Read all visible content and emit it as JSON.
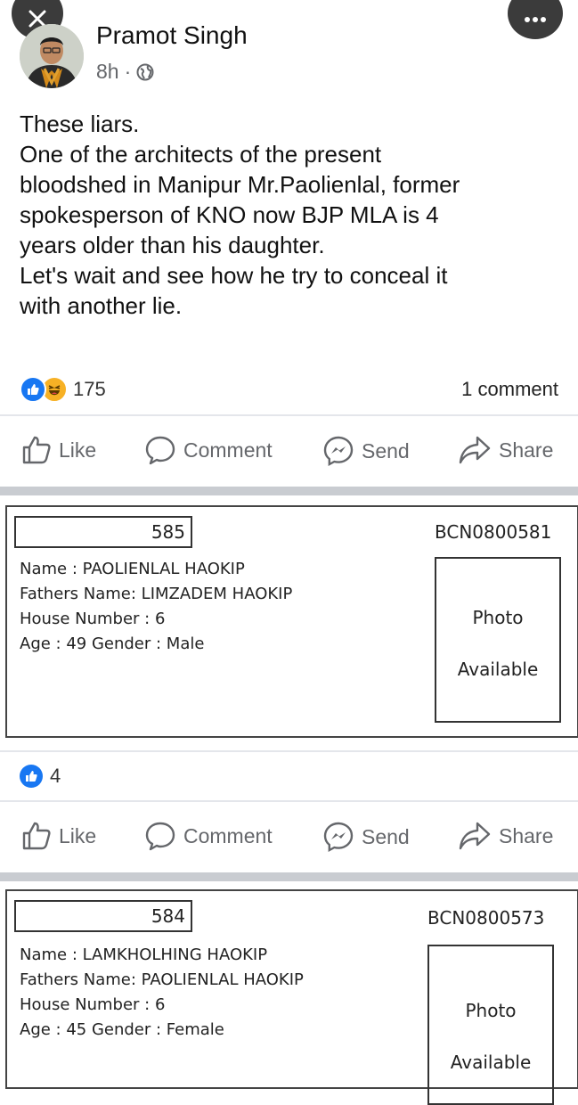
{
  "top_controls": {
    "close_icon": "close-icon",
    "more_icon": "more-options-icon"
  },
  "post": {
    "author": "Pramot Singh",
    "time": "8h",
    "separator": "·",
    "privacy_icon": "globe-icon",
    "text_lines": [
      "These liars.",
      "One of the architects of the present",
      "bloodshed in Manipur Mr.Paolienlal, former",
      "spokesperson of KNO now BJP MLA is 4",
      "years older than his daughter.",
      "Let's wait and see how he try to conceal it",
      "with another lie."
    ],
    "reaction_count": "175",
    "comment_count": "1 comment"
  },
  "actions": {
    "like": "Like",
    "comment": "Comment",
    "send": "Send",
    "share": "Share"
  },
  "cards": [
    {
      "serial": "585",
      "epic_no": "BCN0800581",
      "name_line": "Name : PAOLIENLAL HAOKIP",
      "father_line": "Fathers Name: LIMZADEM HAOKIP",
      "house_line": "House Number : 6",
      "age_line": "Age : 49 Gender : Male",
      "photo_line1": "Photo",
      "photo_line2": "Available",
      "like_count": "4"
    },
    {
      "serial": "584",
      "epic_no": "BCN0800573",
      "name_line": "Name : LAMKHOLHING HAOKIP",
      "father_line": "Fathers Name: PAOLIENLAL HAOKIP",
      "house_line": "House Number : 6",
      "age_line": "Age : 45 Gender : Female",
      "photo_line1": "Photo",
      "photo_line2": "Available"
    }
  ],
  "colors": {
    "facebook_blue": "#1877f2",
    "muted_text": "#65676b",
    "haha_yellow": "#f7b125"
  }
}
